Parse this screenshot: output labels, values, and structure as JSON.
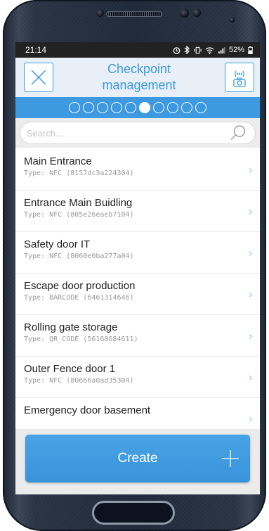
{
  "status_bar": {
    "time": "21:14",
    "battery": "52%"
  },
  "header": {
    "title_line1": "Checkpoint",
    "title_line2": "management",
    "close_icon": "close-icon",
    "scan_icon": "nfc-camera-icon"
  },
  "stepper": {
    "total_steps": 10,
    "active_step": 6
  },
  "search": {
    "placeholder": "Search..."
  },
  "checkpoints": [
    {
      "name": "Main Entrance",
      "detail": "Type: NFC (8157dc3a224304)"
    },
    {
      "name": "Entrance Main Buidling",
      "detail": "Type: NFC (805e26eaeb7104)"
    },
    {
      "name": "Safety door IT",
      "detail": "Type: NFC (8060e0ba277a04)"
    },
    {
      "name": "Escape door production",
      "detail": "Type: BARCODE (6461314646)"
    },
    {
      "name": "Rolling gate storage",
      "detail": "Type: QR_CODE (56160684611)"
    },
    {
      "name": "Outer Fence door 1",
      "detail": "Type: NFC (80666a0ad35304)"
    },
    {
      "name": "Emergency door basement",
      "detail": ""
    }
  ],
  "footer": {
    "create_label": "Create"
  },
  "colors": {
    "accent": "#3d9ae0",
    "header_bg": "#e9eff6"
  }
}
